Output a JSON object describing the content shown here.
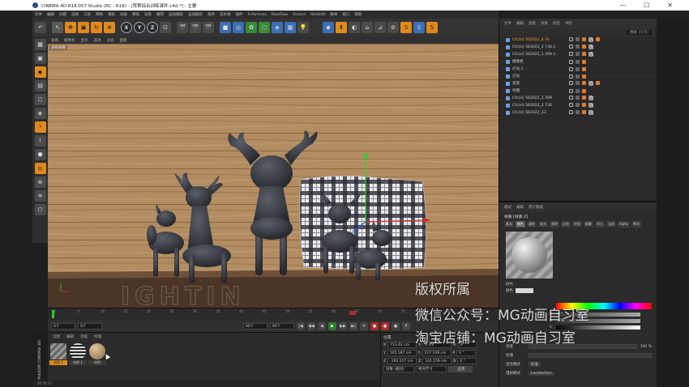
{
  "window": {
    "title": "CINEMA 4D R18.057 Studio (RC - R18) - [梵蒂综合训练课件.c4d *] - 主要",
    "controls": [
      "—",
      "☐",
      "✕"
    ]
  },
  "menubar": [
    "文件",
    "编辑",
    "创建",
    "选择",
    "工具",
    "网格",
    "捕捉",
    "动画",
    "模拟",
    "渲染",
    "雕刻",
    "运动跟踪",
    "运动图形",
    "角色",
    "流水线",
    "插件",
    "X-Particles",
    "RealFlow",
    "Octane",
    "Redshift",
    "脚本",
    "窗口",
    "帮助"
  ],
  "toolbar": {
    "undo": "↶",
    "modes": [
      "↖",
      "✥",
      "▣",
      "↻",
      "⊕"
    ],
    "axes": [
      "X",
      "Y",
      "Z"
    ],
    "coord": "⊡",
    "render": [
      "🎬",
      "🎬",
      "🎬"
    ],
    "primitives": [
      "■",
      "◎",
      "✿",
      "⬡",
      "◈",
      "▦",
      "💡"
    ],
    "right": [
      "◆",
      "⬇",
      "◐",
      "⌂",
      "⊿",
      "⊘",
      "S",
      "S",
      "S"
    ]
  },
  "lefttools": [
    "▦",
    "▣",
    "◆",
    "▤",
    "⬡",
    "◈",
    "└",
    "⌇",
    "⬢",
    "◎",
    "⊛",
    "≋",
    "⬡"
  ],
  "viewport": {
    "menu": [
      "查看",
      "摄像机",
      "显示",
      "选项",
      "过滤",
      "面板"
    ],
    "label": "透视视图"
  },
  "timeline": {
    "ticks": [
      "0",
      "5",
      "10",
      "15",
      "20",
      "25",
      "30",
      "35",
      "40",
      "45",
      "50",
      "55",
      "60",
      "65",
      "70",
      "75",
      "80",
      "85",
      "90"
    ]
  },
  "transport": {
    "start": "0 F",
    "current": "0 F",
    "end": "90 F",
    "end2": "90 F",
    "buttons": [
      "|◀",
      "◀◀",
      "◀",
      "▶",
      "▶▶",
      "▶|",
      "⟳"
    ],
    "record": [
      "●",
      "●",
      "●",
      "P"
    ]
  },
  "materials": {
    "menu": [
      "创建",
      "编辑",
      "功能",
      "纹理"
    ],
    "items": [
      {
        "label": "材质.2",
        "active": true
      },
      {
        "label": "材质.1",
        "active": false
      },
      {
        "label": "材质",
        "active": false
      }
    ]
  },
  "coords": {
    "header": "位置",
    "rows": [
      {
        "axis": "X",
        "pos": "713.41 cm",
        "axis2": "X",
        "size": "0 cm",
        "axis3": "H",
        "rot": "0 °"
      },
      {
        "axis": "Y",
        "pos": "105.187 cm",
        "axis2": "Y",
        "size": "217.539 cm",
        "axis3": "P",
        "rot": "0 °"
      },
      {
        "axis": "Z",
        "pos": "-192.217 cm",
        "axis2": "Z",
        "size": "142.159 cm",
        "axis3": "B",
        "rot": "0 °"
      }
    ],
    "mode": "对象 (相对)",
    "size_mode": "绝对尺寸",
    "apply": "应用"
  },
  "maxon": "MAXON CINEMA 4D",
  "status": "00:00:23",
  "objmgr": {
    "menu": [
      "文件",
      "编辑",
      "查看",
      "对象",
      "标签",
      "书签"
    ],
    "rows": [
      {
        "name": "Cfc(sl) 565022_4 7k",
        "selected": true,
        "tags": 3
      },
      {
        "name": "Cfc(sl) 583022_2 736.1",
        "selected": false,
        "tags": 2
      },
      {
        "name": "Cfc(sl) 583022_1 499.1",
        "selected": false,
        "tags": 2
      },
      {
        "name": "摄像机",
        "selected": false,
        "tags": 1
      },
      {
        "name": "灯光.1",
        "selected": false,
        "tags": 1
      },
      {
        "name": "灯光",
        "selected": false,
        "tags": 1
      },
      {
        "name": "背景",
        "selected": false,
        "tags": 3
      },
      {
        "name": "地面",
        "selected": false,
        "tags": 1
      },
      {
        "name": "Cfc(sl) 583022_1 499",
        "selected": false,
        "tags": 2
      },
      {
        "name": "Cfc(sl) 583022_2 736",
        "selected": false,
        "tags": 2
      },
      {
        "name": "Cfc(sl) 583022_33",
        "selected": false,
        "tags": 2
      }
    ],
    "search": "搜索 (小写)"
  },
  "attrmgr": {
    "menu": [
      "模式",
      "编辑",
      "用户数据"
    ],
    "title": "材质 [材质.2]",
    "tabs": [
      "基本",
      "颜色",
      "漫射",
      "发光",
      "透明",
      "反射",
      "环境",
      "烟雾",
      "凹凸",
      "法线",
      "Alpha",
      "辉光"
    ],
    "section": "颜色",
    "color_label": "颜色",
    "brightness_label": "亮度",
    "brightness_value": "100 %",
    "texture_label": "纹理",
    "mix_label": "混合模式",
    "mix_value": "标准",
    "model_label": "漫射模式",
    "model_value": "Lambertian",
    "hsv": [
      "H",
      "S",
      "V"
    ],
    "hsv_values": [
      "0 °",
      "0 %",
      "80 %"
    ]
  },
  "watermarks": [
    "版权所属",
    "微信公众号：MG动画自习室",
    "淘宝店铺：MG动画自习室"
  ],
  "colors": {
    "accent": "#e08a1e",
    "toolbar_bg": "#333333",
    "panel_bg": "#2b2b2b",
    "floor": "#3a2a20",
    "wood": "#b08a5e",
    "deer": "#3a3d44"
  }
}
